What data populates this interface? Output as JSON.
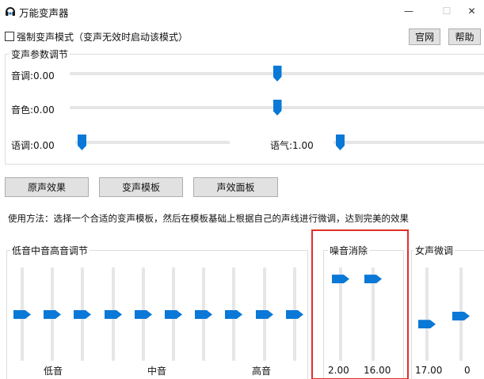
{
  "window": {
    "title": "万能变声器",
    "icon": "headphones-icon",
    "minimize": "—",
    "maximize": "☐",
    "close": "✕"
  },
  "header": {
    "force_mode_label": "强制变声模式（变声无效时启动该模式）",
    "force_mode_checked": false,
    "website_label": "官网",
    "help_label": "帮助"
  },
  "params": {
    "title": "变声参数调节",
    "pitch": {
      "label": "音调:0.00",
      "value": 0.5
    },
    "timbre": {
      "label": "音色:0.00",
      "value": 0.5
    },
    "speed": {
      "label": "语调:0.00",
      "value": 0.0
    },
    "tone": {
      "label": "语气:1.00",
      "value": 0.0
    }
  },
  "buttons": {
    "original": "原声效果",
    "template": "变声模板",
    "effects": "声效面板"
  },
  "usage_text": "使用方法：选择一个合适的变声模板，然后在模板基础上根据自己的声线进行微调，达到完美的效果",
  "equalizer": {
    "title": "低音中音高音调节",
    "levels": [
      0.5,
      0.5,
      0.5,
      0.5,
      0.5,
      0.5,
      0.5,
      0.5,
      0.5,
      0.5
    ],
    "low_label": "低音",
    "mid_label": "中音",
    "high_label": "高音"
  },
  "noise": {
    "title": "噪音消除",
    "levels": [
      0.06,
      0.06
    ],
    "values": [
      "2.00",
      "16.00"
    ]
  },
  "female": {
    "title": "女声微调",
    "levels": [
      0.62,
      0.52
    ],
    "values": [
      "17.00",
      "0"
    ]
  },
  "colors": {
    "accent": "#0a78d7",
    "highlight_border": "#e03027"
  }
}
